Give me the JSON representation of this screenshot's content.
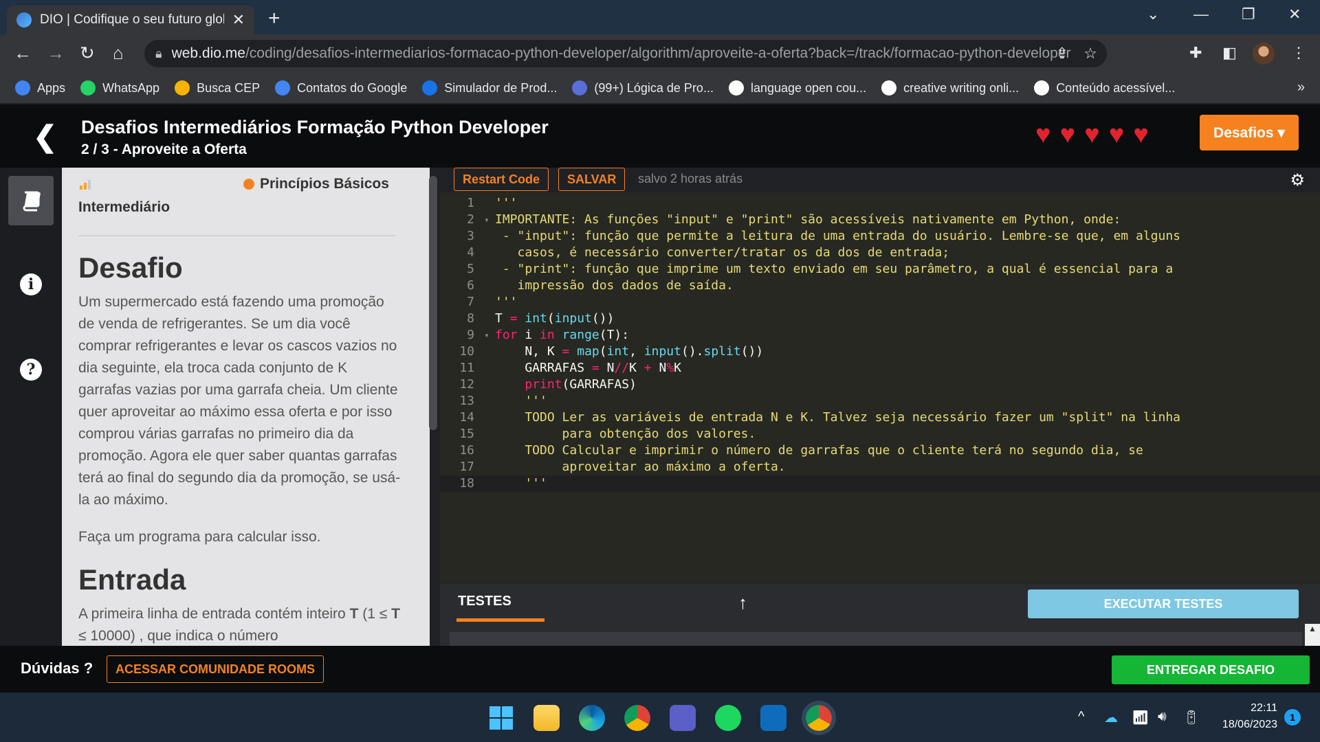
{
  "browser": {
    "tab_title": "DIO | Codifique o seu futuro glob",
    "new_tab": "+",
    "url_host": "web.dio.me",
    "url_path": "/coding/desafios-intermediarios-formacao-python-developer/algorithm/aproveite-a-oferta?back=/track/formacao-python-developer",
    "bookmarks": [
      {
        "label": "Apps",
        "color": "#4285f4"
      },
      {
        "label": "WhatsApp",
        "color": "#25d366"
      },
      {
        "label": "Busca CEP",
        "color": "#f4b400"
      },
      {
        "label": "Contatos do Google",
        "color": "#4285f4"
      },
      {
        "label": "Simulador de Prod...",
        "color": "#1a73e8"
      },
      {
        "label": "(99+) Lógica de Pro...",
        "color": "#5b6dd6"
      },
      {
        "label": "language open cou...",
        "color": "#ffffff"
      },
      {
        "label": "creative writing onli...",
        "color": "#ffffff"
      },
      {
        "label": "Conteúdo acessível...",
        "color": "#ffffff"
      }
    ]
  },
  "header": {
    "title": "Desafios Intermediários Formação Python Developer",
    "subtitle": "2 / 3 - Aproveite a Oferta",
    "hearts": 5,
    "desafios_label": "Desafios ▾"
  },
  "description": {
    "level": "Intermediário",
    "topic": "Princípios Básicos",
    "heading_challenge": "Desafio",
    "paragraph1": "Um supermercado está fazendo uma promoção de venda de refrigerantes. Se um dia você comprar refrigerantes e levar os cascos vazios no dia seguinte, ela troca cada conjunto de K garrafas vazias  por uma garrafa cheia. Um cliente quer aproveitar ao máximo essa oferta e por isso comprou várias garrafas no primeiro dia da promoção. Agora ele quer saber quantas garrafas terá ao final do segundo dia da promoção, se usá-la ao máximo.",
    "paragraph2": "Faça um programa para calcular isso.",
    "heading_input": "Entrada",
    "input_text_a": "A primeira linha de entrada contém inteiro ",
    "input_T": "T",
    "input_text_b": " (1 ≤ ",
    "input_T2": "T",
    "input_text_c": " ≤ 10000) , que indica o número"
  },
  "editor": {
    "restart_label": "Restart Code",
    "save_label": "SALVAR",
    "saved_status": "salvo 2 horas atrás",
    "active_line": 18,
    "lines": [
      [
        {
          "t": "'''",
          "c": "str"
        }
      ],
      [
        {
          "t": "IMPORTANTE: As funções \"input\" e \"print\" são acessíveis nativamente em Python, onde:",
          "c": "str"
        }
      ],
      [
        {
          "t": " - \"input\": função que permite a leitura de uma entrada do usuário. Lembre-se que, em alguns",
          "c": "str"
        }
      ],
      [
        {
          "t": "   casos, é necessário converter/tratar os da dos de entrada;",
          "c": "str"
        }
      ],
      [
        {
          "t": " - \"print\": função que imprime um texto enviado em seu parâmetro, a qual é essencial para a",
          "c": "str"
        }
      ],
      [
        {
          "t": "   impressão dos dados de saída.",
          "c": "str"
        }
      ],
      [
        {
          "t": "'''",
          "c": "str"
        }
      ],
      [
        {
          "t": "T ",
          "c": ""
        },
        {
          "t": "=",
          "c": "kw"
        },
        {
          "t": " ",
          "c": ""
        },
        {
          "t": "int",
          "c": "fn"
        },
        {
          "t": "(",
          "c": ""
        },
        {
          "t": "input",
          "c": "fn"
        },
        {
          "t": "())",
          "c": ""
        }
      ],
      [
        {
          "t": "for",
          "c": "kw"
        },
        {
          "t": " i ",
          "c": ""
        },
        {
          "t": "in",
          "c": "kw"
        },
        {
          "t": " ",
          "c": ""
        },
        {
          "t": "range",
          "c": "fn"
        },
        {
          "t": "(T):",
          "c": ""
        }
      ],
      [
        {
          "t": "    N, K ",
          "c": ""
        },
        {
          "t": "=",
          "c": "kw"
        },
        {
          "t": " ",
          "c": ""
        },
        {
          "t": "map",
          "c": "fn"
        },
        {
          "t": "(",
          "c": ""
        },
        {
          "t": "int",
          "c": "fn"
        },
        {
          "t": ", ",
          "c": ""
        },
        {
          "t": "input",
          "c": "fn"
        },
        {
          "t": "().",
          "c": ""
        },
        {
          "t": "split",
          "c": "fn"
        },
        {
          "t": "())",
          "c": ""
        }
      ],
      [
        {
          "t": "    GARRAFAS ",
          "c": ""
        },
        {
          "t": "=",
          "c": "kw"
        },
        {
          "t": " N",
          "c": ""
        },
        {
          "t": "//",
          "c": "kw"
        },
        {
          "t": "K ",
          "c": ""
        },
        {
          "t": "+",
          "c": "kw"
        },
        {
          "t": " N",
          "c": ""
        },
        {
          "t": "%",
          "c": "kw"
        },
        {
          "t": "K",
          "c": ""
        }
      ],
      [
        {
          "t": "    ",
          "c": ""
        },
        {
          "t": "print",
          "c": "kw"
        },
        {
          "t": "(GARRAFAS)",
          "c": ""
        }
      ],
      [
        {
          "t": "    '''",
          "c": "str"
        }
      ],
      [
        {
          "t": "    TODO Ler as variáveis de entrada N e K. Talvez seja necessário fazer um \"split\" na linha",
          "c": "str"
        }
      ],
      [
        {
          "t": "         para obtenção dos valores.",
          "c": "str"
        }
      ],
      [
        {
          "t": "    TODO Calcular e imprimir o número de garrafas que o cliente terá no segundo dia, se",
          "c": "str"
        }
      ],
      [
        {
          "t": "         aproveitar ao máximo a oferta.",
          "c": "str"
        }
      ],
      [
        {
          "t": "    '''",
          "c": "str"
        }
      ]
    ],
    "fold_lines": [
      2,
      9
    ]
  },
  "tests": {
    "tab_label": "TESTES",
    "arrow": "↑",
    "run_label": "EXECUTAR TESTES"
  },
  "footer": {
    "question": "Dúvidas ?",
    "community_label": "ACESSAR COMUNIDADE ROOMS",
    "submit_label": "ENTREGAR DESAFIO"
  },
  "taskbar": {
    "time": "22:11",
    "date": "18/06/2023",
    "notifications": "1"
  }
}
